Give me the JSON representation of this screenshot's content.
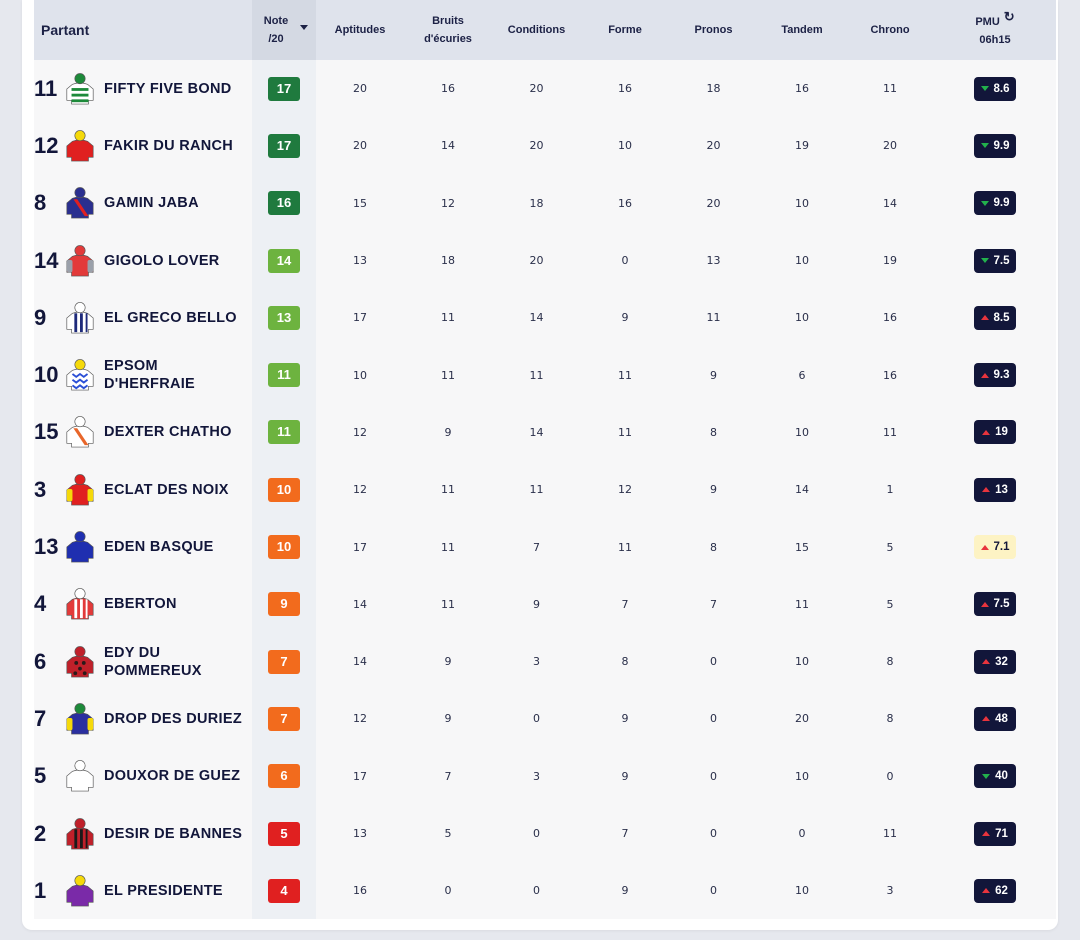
{
  "header": {
    "partant": "Partant",
    "note_line1": "Note",
    "note_line2": "/20",
    "aptitudes": "Aptitudes",
    "bruits_line1": "Bruits",
    "bruits_line2": "d'écuries",
    "conditions": "Conditions",
    "forme": "Forme",
    "pronos": "Pronos",
    "tandem": "Tandem",
    "chrono": "Chrono",
    "pmu_line1": "PMU",
    "pmu_line2": "06h15",
    "refresh_icon": "refresh-icon"
  },
  "colors": {
    "note_dark_green": "#1f7a3e",
    "note_light_green": "#6db33f",
    "note_orange": "#f26b1d",
    "note_red": "#e02020",
    "odds_dark": "#12163a",
    "odds_fav": "#fdf3c4",
    "arrow_down": "#22b14c",
    "arrow_up": "#e8343d"
  },
  "runners": [
    {
      "num": "11",
      "name_line1": "FIFTY FIVE BOND",
      "name_line2": "",
      "note": "17",
      "note_tier": "dark",
      "aptitudes": "20",
      "bruits": "16",
      "conditions": "20",
      "forme": "16",
      "pronos": "18",
      "tandem": "16",
      "chrono": "11",
      "odds": "8.6",
      "trend": "down",
      "fav": false,
      "silk": {
        "body": "#ffffff",
        "stripe": "#1d8a3a",
        "cap": "#1d8a3a",
        "pattern": "hoops"
      }
    },
    {
      "num": "12",
      "name_line1": "FAKIR DU RANCH",
      "name_line2": "",
      "note": "17",
      "note_tier": "dark",
      "aptitudes": "20",
      "bruits": "14",
      "conditions": "20",
      "forme": "10",
      "pronos": "20",
      "tandem": "19",
      "chrono": "20",
      "odds": "9.9",
      "trend": "down",
      "fav": false,
      "silk": {
        "body": "#e02020",
        "stripe": "#e02020",
        "cap": "#f5d90a",
        "pattern": "plain"
      }
    },
    {
      "num": "8",
      "name_line1": "GAMIN JABA",
      "name_line2": "",
      "note": "16",
      "note_tier": "dark",
      "aptitudes": "15",
      "bruits": "12",
      "conditions": "18",
      "forme": "16",
      "pronos": "20",
      "tandem": "10",
      "chrono": "14",
      "odds": "9.9",
      "trend": "down",
      "fav": false,
      "silk": {
        "body": "#2a2f8f",
        "stripe": "#e02020",
        "cap": "#2a2f8f",
        "pattern": "sash"
      }
    },
    {
      "num": "14",
      "name_line1": "GIGOLO LOVER",
      "name_line2": "",
      "note": "14",
      "note_tier": "light",
      "aptitudes": "13",
      "bruits": "18",
      "conditions": "20",
      "forme": "0",
      "pronos": "13",
      "tandem": "10",
      "chrono": "19",
      "odds": "7.5",
      "trend": "down",
      "fav": false,
      "silk": {
        "body": "#e23a3a",
        "stripe": "#9aa0aa",
        "cap": "#e23a3a",
        "pattern": "sleeves"
      }
    },
    {
      "num": "9",
      "name_line1": "EL GRECO BELLO",
      "name_line2": "",
      "note": "13",
      "note_tier": "light",
      "aptitudes": "17",
      "bruits": "11",
      "conditions": "14",
      "forme": "9",
      "pronos": "11",
      "tandem": "10",
      "chrono": "16",
      "odds": "8.5",
      "trend": "up",
      "fav": false,
      "silk": {
        "body": "#ffffff",
        "stripe": "#1e2a7a",
        "cap": "#ffffff",
        "pattern": "stripes"
      }
    },
    {
      "num": "10",
      "name_line1": "EPSOM",
      "name_line2": "D'HERFRAIE",
      "note": "11",
      "note_tier": "light",
      "aptitudes": "10",
      "bruits": "11",
      "conditions": "11",
      "forme": "11",
      "pronos": "9",
      "tandem": "6",
      "chrono": "16",
      "odds": "9.3",
      "trend": "up",
      "fav": false,
      "silk": {
        "body": "#ffffff",
        "stripe": "#2b4fd6",
        "cap": "#f5d90a",
        "pattern": "zigzag"
      }
    },
    {
      "num": "15",
      "name_line1": "DEXTER CHATHO",
      "name_line2": "",
      "note": "11",
      "note_tier": "light",
      "aptitudes": "12",
      "bruits": "9",
      "conditions": "14",
      "forme": "11",
      "pronos": "8",
      "tandem": "10",
      "chrono": "11",
      "odds": "19",
      "trend": "up",
      "fav": false,
      "silk": {
        "body": "#ffffff",
        "stripe": "#e8662a",
        "cap": "#ffffff",
        "pattern": "sash"
      }
    },
    {
      "num": "3",
      "name_line1": "ECLAT DES NOIX",
      "name_line2": "",
      "note": "10",
      "note_tier": "orange",
      "aptitudes": "12",
      "bruits": "11",
      "conditions": "11",
      "forme": "12",
      "pronos": "9",
      "tandem": "14",
      "chrono": "1",
      "odds": "13",
      "trend": "up",
      "fav": false,
      "silk": {
        "body": "#e02020",
        "stripe": "#f5d90a",
        "cap": "#e02020",
        "pattern": "sleeves"
      }
    },
    {
      "num": "13",
      "name_line1": "EDEN BASQUE",
      "name_line2": "",
      "note": "10",
      "note_tier": "orange",
      "aptitudes": "17",
      "bruits": "11",
      "conditions": "7",
      "forme": "11",
      "pronos": "8",
      "tandem": "15",
      "chrono": "5",
      "odds": "7.1",
      "trend": "up",
      "fav": true,
      "silk": {
        "body": "#1f2fb0",
        "stripe": "#1f2fb0",
        "cap": "#1f2fb0",
        "pattern": "plain"
      }
    },
    {
      "num": "4",
      "name_line1": "EBERTON",
      "name_line2": "",
      "note": "9",
      "note_tier": "orange",
      "aptitudes": "14",
      "bruits": "11",
      "conditions": "9",
      "forme": "7",
      "pronos": "7",
      "tandem": "11",
      "chrono": "5",
      "odds": "7.5",
      "trend": "up",
      "fav": false,
      "silk": {
        "body": "#e23a3a",
        "stripe": "#ffffff",
        "cap": "#ffffff",
        "pattern": "stripes"
      }
    },
    {
      "num": "6",
      "name_line1": "EDY DU",
      "name_line2": "POMMEREUX",
      "note": "7",
      "note_tier": "orange",
      "aptitudes": "14",
      "bruits": "9",
      "conditions": "3",
      "forme": "8",
      "pronos": "0",
      "tandem": "10",
      "chrono": "8",
      "odds": "32",
      "trend": "up",
      "fav": false,
      "silk": {
        "body": "#c0202a",
        "stripe": "#2a1a1a",
        "cap": "#c0202a",
        "pattern": "spots"
      }
    },
    {
      "num": "7",
      "name_line1": "DROP DES DURIEZ",
      "name_line2": "",
      "note": "7",
      "note_tier": "orange",
      "aptitudes": "12",
      "bruits": "9",
      "conditions": "0",
      "forme": "9",
      "pronos": "0",
      "tandem": "20",
      "chrono": "8",
      "odds": "48",
      "trend": "up",
      "fav": false,
      "silk": {
        "body": "#2a2f9f",
        "stripe": "#f5d90a",
        "cap": "#1d8a3a",
        "pattern": "sleeves"
      }
    },
    {
      "num": "5",
      "name_line1": "DOUXOR DE GUEZ",
      "name_line2": "",
      "note": "6",
      "note_tier": "orange",
      "aptitudes": "17",
      "bruits": "7",
      "conditions": "3",
      "forme": "9",
      "pronos": "0",
      "tandem": "10",
      "chrono": "0",
      "odds": "40",
      "trend": "down",
      "fav": false,
      "silk": {
        "body": "#ffffff",
        "stripe": "#d8d8d8",
        "cap": "#ffffff",
        "pattern": "plain"
      }
    },
    {
      "num": "2",
      "name_line1": "DESIR DE BANNES",
      "name_line2": "",
      "note": "5",
      "note_tier": "red",
      "aptitudes": "13",
      "bruits": "5",
      "conditions": "0",
      "forme": "7",
      "pronos": "0",
      "tandem": "0",
      "chrono": "11",
      "odds": "71",
      "trend": "up",
      "fav": false,
      "silk": {
        "body": "#c0202a",
        "stripe": "#1a1a1a",
        "cap": "#c0202a",
        "pattern": "stripes"
      }
    },
    {
      "num": "1",
      "name_line1": "EL PRESIDENTE",
      "name_line2": "",
      "note": "4",
      "note_tier": "red",
      "aptitudes": "16",
      "bruits": "0",
      "conditions": "0",
      "forme": "9",
      "pronos": "0",
      "tandem": "10",
      "chrono": "3",
      "odds": "62",
      "trend": "up",
      "fav": false,
      "silk": {
        "body": "#7a2aa8",
        "stripe": "#f5d90a",
        "cap": "#f5d90a",
        "pattern": "plain"
      }
    }
  ]
}
